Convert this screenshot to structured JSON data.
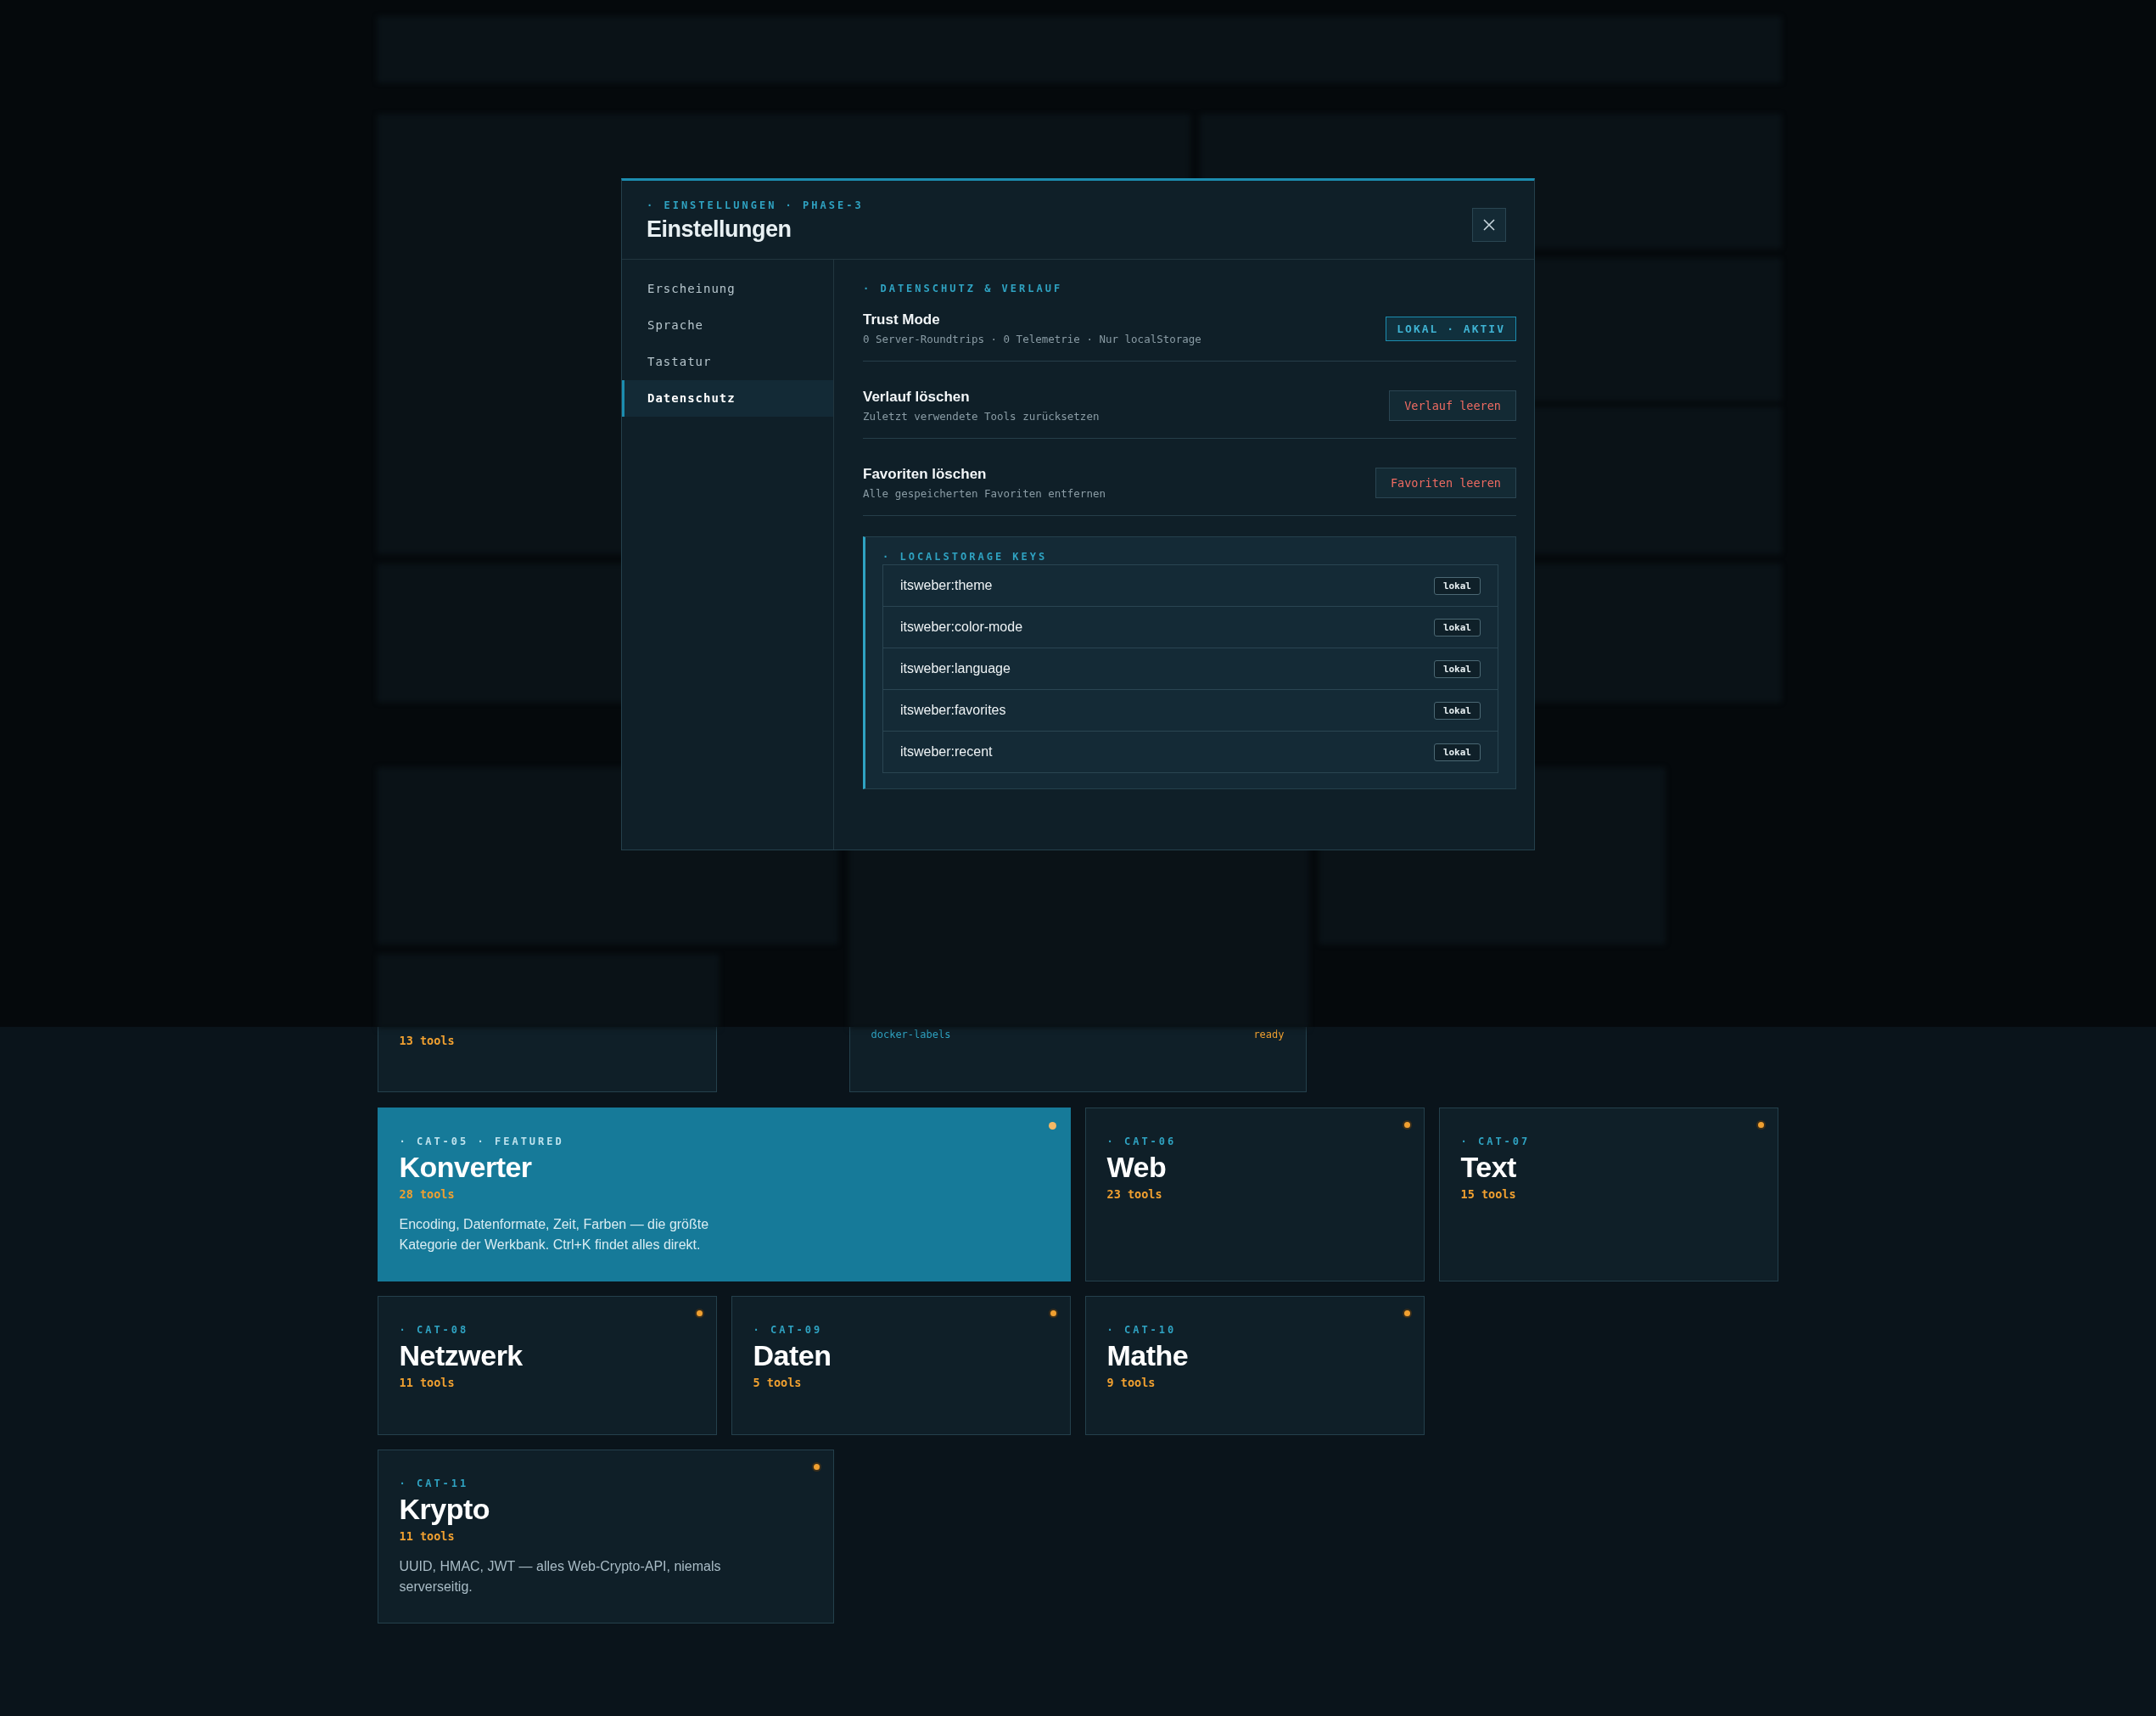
{
  "settings_modal": {
    "kicker": "· EINSTELLUNGEN · PHASE-3",
    "title": "Einstellungen",
    "nav": [
      {
        "label": "Erscheinung",
        "selected": false
      },
      {
        "label": "Sprache",
        "selected": false
      },
      {
        "label": "Tastatur",
        "selected": false
      },
      {
        "label": "Datenschutz",
        "selected": true
      }
    ],
    "section_label": "· DATENSCHUTZ & VERLAUF",
    "rows": [
      {
        "kind": "badge",
        "title": "Trust Mode",
        "description": "0 Server-Roundtrips · 0 Telemetrie · Nur localStorage",
        "action": "LOKAL · AKTIV"
      },
      {
        "kind": "danger",
        "title": "Verlauf löschen",
        "description": "Zuletzt verwendete Tools zurücksetzen",
        "action": "Verlauf leeren"
      },
      {
        "kind": "danger",
        "title": "Favoriten löschen",
        "description": "Alle gespeicherten Favoriten entfernen",
        "action": "Favoriten leeren"
      }
    ],
    "storage": {
      "label": "· LOCALSTORAGE KEYS",
      "keys": [
        {
          "key": "itsweber:theme",
          "badge": "lokal"
        },
        {
          "key": "itsweber:color-mode",
          "badge": "lokal"
        },
        {
          "key": "itsweber:language",
          "badge": "lokal"
        },
        {
          "key": "itsweber:favorites",
          "badge": "lokal"
        },
        {
          "key": "itsweber:recent",
          "badge": "lokal"
        }
      ]
    }
  },
  "partial_cards": {
    "count": "13 tools",
    "tool_rows": [
      {
        "name": "docker-labels",
        "status": "ready"
      }
    ]
  },
  "category_rows": [
    {
      "cards": [
        {
          "label": "· CAT-05 · FEATURED",
          "title": "Konverter",
          "count": "28 tools",
          "description": "Encoding, Datenformate, Zeit, Farben — die größte Kategorie der Werkbank. Ctrl+K findet alles direkt.",
          "featured": true
        },
        {
          "label": "· CAT-06",
          "title": "Web",
          "count": "23 tools",
          "featured": false
        },
        {
          "label": "· CAT-07",
          "title": "Text",
          "count": "15 tools",
          "featured": false
        }
      ]
    },
    {
      "cards": [
        {
          "label": "· CAT-08",
          "title": "Netzwerk",
          "count": "11 tools",
          "featured": false
        },
        {
          "label": "· CAT-09",
          "title": "Daten",
          "count": "5 tools",
          "featured": false
        },
        {
          "label": "· CAT-10",
          "title": "Mathe",
          "count": "9 tools",
          "featured": false
        }
      ]
    },
    {
      "cards": [
        {
          "label": "· CAT-11",
          "title": "Krypto",
          "count": "11 tools",
          "description": "UUID, HMAC, JWT — alles Web-Crypto-API, niemals serverseitig.",
          "featured": false
        }
      ]
    }
  ]
}
